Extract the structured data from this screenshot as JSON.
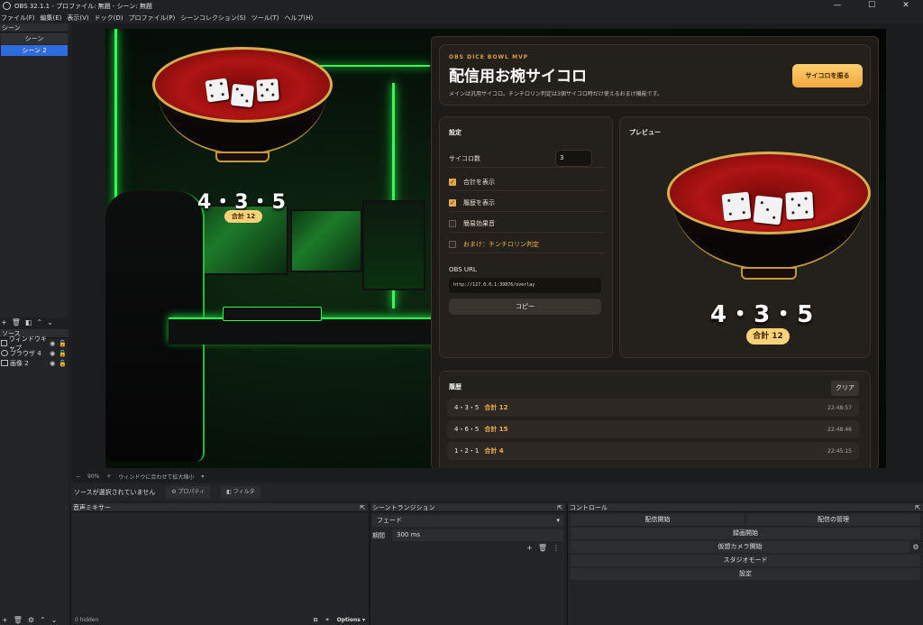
{
  "window": {
    "title": "OBS 32.1.1 - プロファイル: 無題 - シーン: 無題",
    "minimize": "—",
    "maximize": "☐",
    "close": "✕"
  },
  "menu": [
    "ファイル(F)",
    "編集(E)",
    "表示(V)",
    "ドック(D)",
    "プロファイル(P)",
    "シーンコレクション(S)",
    "ツール(T)",
    "ヘルプ(H)"
  ],
  "scenes": {
    "header": "シーン",
    "items": [
      "シーン",
      "シーン 2"
    ]
  },
  "sources": {
    "header": "ソース",
    "items": [
      "ウィンドウキャプ",
      "ブラウザ 4",
      "画像 2"
    ]
  },
  "overlay": {
    "roll": "4・3・5",
    "sum": "合計 12"
  },
  "app": {
    "eyebrow": "OBS DICE BOWL MVP",
    "title": "配信用お椀サイコロ",
    "subtitle": "メインは汎用サイコロ。チンチロリン判定は3個サイコロ時だけ使えるおまけ機能です。",
    "roll_button": "サイコロを振る",
    "settings": {
      "title": "設定",
      "dice_count_label": "サイコロ数",
      "dice_count_value": "3",
      "options": [
        {
          "label": "合計を表示",
          "checked": true
        },
        {
          "label": "履歴を表示",
          "checked": true
        },
        {
          "label": "簡易効果音",
          "checked": false
        },
        {
          "label": "おまけ：チンチロリン判定",
          "checked": false
        }
      ],
      "url_label": "OBS URL",
      "url_value": "http://127.0.0.1:39876/overlay",
      "copy_button": "コピー"
    },
    "preview": {
      "title": "プレビュー",
      "roll": "4・3・5",
      "sum": "合計 12"
    },
    "history": {
      "title": "履歴",
      "clear_button": "クリア",
      "rows": [
        {
          "roll": "4・3・5",
          "sum": "合計 12",
          "time": "22:48:57"
        },
        {
          "roll": "4・6・5",
          "sum": "合計 15",
          "time": "22:48:46"
        },
        {
          "roll": "1・2・1",
          "sum": "合計 4",
          "time": "22:45:15"
        }
      ]
    }
  },
  "zoom": {
    "value": "90%",
    "fit_label": "ウィンドウに合わせて拡大縮小"
  },
  "context": {
    "no_source": "ソースが選択されていません",
    "properties": "プロパティ",
    "filters": "フィルタ"
  },
  "mixer": {
    "header": "音声ミキサー",
    "hidden": "0 hidden",
    "options": "Options"
  },
  "transition": {
    "header": "シーントランジション",
    "type": "フェード",
    "duration_label": "期間",
    "duration_value": "300 ms"
  },
  "controls": {
    "header": "コントロール",
    "start_stream": "配信開始",
    "manage_stream": "配信の管理",
    "start_record": "録画開始",
    "start_vcam": "仮想カメラ開始",
    "studio_mode": "スタジオモード",
    "settings": "設定"
  },
  "colors": {
    "accent": "#e7a94b",
    "scene_active": "#2f6bdc",
    "neon": "#33ff55"
  }
}
